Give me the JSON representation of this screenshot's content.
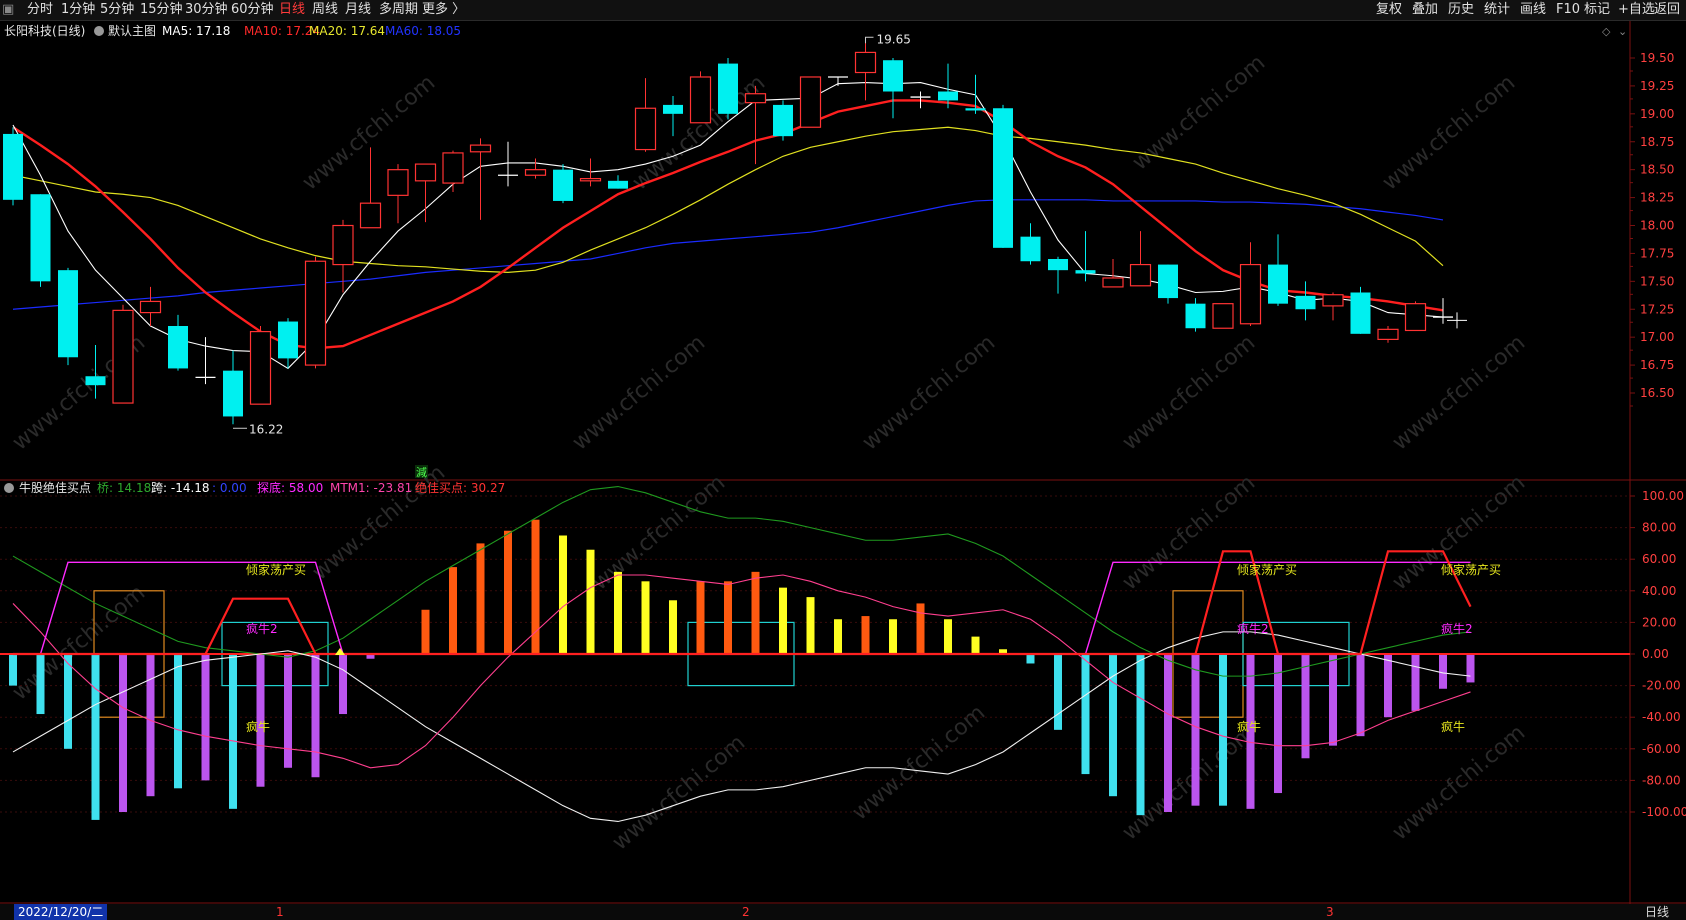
{
  "toolbar": {
    "periods": [
      "分时",
      "1分钟",
      "5分钟",
      "15分钟",
      "30分钟",
      "60分钟",
      "日线",
      "周线",
      "月线",
      "多周期",
      "更多 〉"
    ],
    "active_period": "日线",
    "right_buttons": [
      "复权",
      "叠加",
      "历史",
      "统计",
      "画线",
      "F10",
      "标记",
      "+自选",
      "返回"
    ]
  },
  "main_panel": {
    "stock_name": "长阳科技(日线)",
    "template": "默认主图",
    "ma": [
      {
        "label": "MA5: 17.18",
        "color": "#ffffff"
      },
      {
        "label": "MA10: 17.24",
        "color": "#ff2a2a"
      },
      {
        "label": "MA20: 17.64",
        "color": "#e6e62e"
      },
      {
        "label": "MA60: 18.05",
        "color": "#2233ff"
      }
    ],
    "high_label": "19.65",
    "low_label": "16.22",
    "marker": "減",
    "price_ticks": [
      "19.50",
      "19.25",
      "19.00",
      "18.75",
      "18.50",
      "18.25",
      "18.00",
      "17.75",
      "17.50",
      "17.25",
      "17.00",
      "16.75",
      "16.50"
    ]
  },
  "sub_panel": {
    "title": "牛股绝佳买点",
    "params": [
      {
        "label": "桥: 14.18",
        "color": "#2ea82e"
      },
      {
        "label": "跨: -14.18",
        "color": "#ffffff"
      },
      {
        "label": ": 0.00",
        "color": "#3344ff"
      },
      {
        "label": "探底: 58.00",
        "color": "#ff2aff"
      },
      {
        "label": "MTM1: -23.81",
        "color": "#ff44aa"
      },
      {
        "label": "绝佳买点: 30.27",
        "color": "#ff3333"
      }
    ],
    "ticks": [
      "100.00",
      "80.00",
      "60.00",
      "40.00",
      "20.00",
      "0.00",
      "-20.00",
      "-40.00",
      "-60.00",
      "-80.00",
      "-100.00"
    ],
    "annotations": {
      "qingjia": "倾家荡产买",
      "fengniu2": "疯牛2",
      "fengniu": "疯牛"
    }
  },
  "bottom": {
    "date": "2022/12/20/二",
    "month_marks": [
      "1",
      "2",
      "3"
    ],
    "period_label": "日线"
  },
  "watermark": "www.cfchi.com",
  "candles": [
    {
      "o": 18.82,
      "h": 18.88,
      "l": 18.18,
      "c": 18.23
    },
    {
      "o": 18.28,
      "h": 18.28,
      "l": 17.45,
      "c": 17.5
    },
    {
      "o": 17.6,
      "h": 17.62,
      "l": 16.75,
      "c": 16.82
    },
    {
      "o": 16.65,
      "h": 16.93,
      "l": 16.45,
      "c": 16.57
    },
    {
      "o": 16.41,
      "h": 17.29,
      "l": 16.41,
      "c": 17.24
    },
    {
      "o": 17.22,
      "h": 17.45,
      "l": 17.1,
      "c": 17.32
    },
    {
      "o": 17.1,
      "h": 17.2,
      "l": 16.7,
      "c": 16.72
    },
    {
      "o": 16.63,
      "h": 17.0,
      "l": 16.58,
      "c": 16.64
    },
    {
      "o": 16.7,
      "h": 16.88,
      "l": 16.22,
      "c": 16.29
    },
    {
      "o": 16.4,
      "h": 17.1,
      "l": 16.4,
      "c": 17.05
    },
    {
      "o": 17.14,
      "h": 17.17,
      "l": 16.72,
      "c": 16.81
    },
    {
      "o": 16.75,
      "h": 17.72,
      "l": 16.72,
      "c": 17.68
    },
    {
      "o": 17.65,
      "h": 18.05,
      "l": 17.4,
      "c": 18.0
    },
    {
      "o": 17.98,
      "h": 18.7,
      "l": 17.98,
      "c": 18.2
    },
    {
      "o": 18.27,
      "h": 18.55,
      "l": 18.02,
      "c": 18.5
    },
    {
      "o": 18.4,
      "h": 18.55,
      "l": 18.03,
      "c": 18.55
    },
    {
      "o": 18.38,
      "h": 18.67,
      "l": 18.3,
      "c": 18.65
    },
    {
      "o": 18.66,
      "h": 18.78,
      "l": 18.05,
      "c": 18.72
    },
    {
      "o": 18.45,
      "h": 18.75,
      "l": 18.35,
      "c": 18.45
    },
    {
      "o": 18.45,
      "h": 18.6,
      "l": 18.42,
      "c": 18.5
    },
    {
      "o": 18.5,
      "h": 18.55,
      "l": 18.2,
      "c": 18.22
    },
    {
      "o": 18.4,
      "h": 18.6,
      "l": 18.35,
      "c": 18.42
    },
    {
      "o": 18.4,
      "h": 18.45,
      "l": 18.33,
      "c": 18.33
    },
    {
      "o": 18.68,
      "h": 19.32,
      "l": 18.66,
      "c": 19.05
    },
    {
      "o": 19.08,
      "h": 19.16,
      "l": 18.8,
      "c": 19.0
    },
    {
      "o": 18.92,
      "h": 19.38,
      "l": 18.92,
      "c": 19.33
    },
    {
      "o": 19.45,
      "h": 19.5,
      "l": 18.95,
      "c": 19.0
    },
    {
      "o": 19.1,
      "h": 19.25,
      "l": 18.55,
      "c": 19.18
    },
    {
      "o": 19.08,
      "h": 19.12,
      "l": 18.76,
      "c": 18.8
    },
    {
      "o": 18.88,
      "h": 19.33,
      "l": 18.88,
      "c": 19.33
    },
    {
      "o": 19.33,
      "h": 19.33,
      "l": 19.25,
      "c": 19.33
    },
    {
      "o": 19.37,
      "h": 19.65,
      "l": 19.12,
      "c": 19.55
    },
    {
      "o": 19.48,
      "h": 19.5,
      "l": 18.96,
      "c": 19.2
    },
    {
      "o": 19.15,
      "h": 19.2,
      "l": 19.05,
      "c": 19.15
    },
    {
      "o": 19.2,
      "h": 19.45,
      "l": 19.05,
      "c": 19.12
    },
    {
      "o": 19.05,
      "h": 19.35,
      "l": 19.0,
      "c": 19.03
    },
    {
      "o": 19.05,
      "h": 19.08,
      "l": 17.8,
      "c": 17.8
    },
    {
      "o": 17.9,
      "h": 18.02,
      "l": 17.65,
      "c": 17.68
    },
    {
      "o": 17.7,
      "h": 17.72,
      "l": 17.39,
      "c": 17.6
    },
    {
      "o": 17.6,
      "h": 17.95,
      "l": 17.5,
      "c": 17.57
    },
    {
      "o": 17.45,
      "h": 17.7,
      "l": 17.45,
      "c": 17.53
    },
    {
      "o": 17.46,
      "h": 17.95,
      "l": 17.46,
      "c": 17.65
    },
    {
      "o": 17.65,
      "h": 17.65,
      "l": 17.3,
      "c": 17.35
    },
    {
      "o": 17.3,
      "h": 17.35,
      "l": 17.05,
      "c": 17.08
    },
    {
      "o": 17.08,
      "h": 17.3,
      "l": 17.08,
      "c": 17.3
    },
    {
      "o": 17.12,
      "h": 17.85,
      "l": 17.1,
      "c": 17.65
    },
    {
      "o": 17.65,
      "h": 17.92,
      "l": 17.28,
      "c": 17.3
    },
    {
      "o": 17.37,
      "h": 17.5,
      "l": 17.15,
      "c": 17.25
    },
    {
      "o": 17.28,
      "h": 17.4,
      "l": 17.15,
      "c": 17.38
    },
    {
      "o": 17.4,
      "h": 17.45,
      "l": 17.03,
      "c": 17.03
    },
    {
      "o": 16.98,
      "h": 17.1,
      "l": 16.95,
      "c": 17.07
    },
    {
      "o": 17.06,
      "h": 17.32,
      "l": 17.06,
      "c": 17.3
    },
    {
      "o": 17.18,
      "h": 17.35,
      "l": 17.12,
      "c": 17.18
    }
  ],
  "ma_series": {
    "ma5": [
      18.9,
      18.45,
      17.95,
      17.6,
      17.35,
      17.1,
      16.98,
      16.92,
      16.88,
      16.87,
      16.72,
      16.97,
      17.38,
      17.68,
      17.95,
      18.15,
      18.37,
      18.53,
      18.56,
      18.56,
      18.53,
      18.48,
      18.5,
      18.55,
      18.62,
      18.72,
      18.93,
      19.12,
      19.13,
      19.14,
      19.27,
      19.28,
      19.27,
      19.28,
      19.22,
      19.17,
      18.78,
      18.3,
      17.87,
      17.57,
      17.55,
      17.52,
      17.47,
      17.4,
      17.41,
      17.45,
      17.4,
      17.33,
      17.35,
      17.32,
      17.22,
      17.2,
      17.18
    ],
    "ma10": [
      18.88,
      18.72,
      18.55,
      18.35,
      18.12,
      17.88,
      17.62,
      17.4,
      17.22,
      17.05,
      16.93,
      16.9,
      16.92,
      17.02,
      17.12,
      17.22,
      17.32,
      17.45,
      17.62,
      17.8,
      17.98,
      18.13,
      18.28,
      18.38,
      18.47,
      18.57,
      18.66,
      18.76,
      18.82,
      18.92,
      19.02,
      19.07,
      19.12,
      19.12,
      19.1,
      19.07,
      18.93,
      18.75,
      18.62,
      18.52,
      18.37,
      18.17,
      17.97,
      17.77,
      17.6,
      17.5,
      17.42,
      17.4,
      17.37,
      17.35,
      17.32,
      17.28,
      17.24
    ],
    "ma20": [
      18.45,
      18.4,
      18.35,
      18.3,
      18.28,
      18.25,
      18.18,
      18.08,
      17.98,
      17.88,
      17.8,
      17.73,
      17.68,
      17.66,
      17.64,
      17.63,
      17.61,
      17.59,
      17.58,
      17.6,
      17.67,
      17.78,
      17.88,
      17.98,
      18.1,
      18.23,
      18.37,
      18.5,
      18.62,
      18.7,
      18.75,
      18.8,
      18.84,
      18.86,
      18.88,
      18.85,
      18.8,
      18.78,
      18.75,
      18.72,
      18.68,
      18.65,
      18.6,
      18.55,
      18.47,
      18.4,
      18.33,
      18.27,
      18.2,
      18.1,
      17.98,
      17.86,
      17.64
    ],
    "ma60": [
      17.25,
      17.27,
      17.29,
      17.31,
      17.33,
      17.35,
      17.37,
      17.4,
      17.42,
      17.44,
      17.46,
      17.48,
      17.5,
      17.52,
      17.55,
      17.58,
      17.6,
      17.62,
      17.64,
      17.66,
      17.68,
      17.7,
      17.75,
      17.8,
      17.84,
      17.86,
      17.88,
      17.9,
      17.92,
      17.94,
      17.98,
      18.03,
      18.08,
      18.13,
      18.18,
      18.22,
      18.23,
      18.23,
      18.23,
      18.23,
      18.22,
      18.22,
      18.22,
      18.22,
      18.21,
      18.21,
      18.2,
      18.19,
      18.17,
      18.15,
      18.12,
      18.09,
      18.05
    ]
  },
  "indicator": {
    "bars": [
      -20,
      -38,
      -60,
      -105,
      -100,
      -90,
      -85,
      -80,
      -98,
      -84,
      -72,
      -78,
      -38,
      -3,
      0,
      28,
      55,
      70,
      78,
      85,
      75,
      66,
      52,
      46,
      34,
      46,
      46,
      52,
      42,
      36,
      22,
      24,
      22,
      32,
      22,
      11,
      3,
      -6,
      -48,
      -76,
      -90,
      -102,
      -100,
      -96,
      -96,
      -98,
      -88,
      -66,
      -58,
      -52,
      -40,
      -36,
      -22,
      -18
    ],
    "bar_colors": [
      "cyan",
      "cyan",
      "cyan",
      "cyan",
      "purple",
      "purple",
      "cyan",
      "purple",
      "cyan",
      "purple",
      "purple",
      "purple",
      "purple",
      "purple",
      "red",
      "orangered",
      "orangered",
      "orangered",
      "orangered",
      "orangered",
      "yellow",
      "yellow",
      "yellow",
      "yellow",
      "yellow",
      "orangered",
      "orangered",
      "orangered",
      "yellow",
      "yellow",
      "yellow",
      "orangered",
      "yellow",
      "orangered",
      "yellow",
      "yellow",
      "yellow",
      "cyan",
      "cyan",
      "cyan",
      "cyan",
      "cyan",
      "purple",
      "purple",
      "cyan",
      "purple",
      "purple",
      "purple",
      "purple",
      "purple",
      "purple",
      "purple",
      "purple",
      "purple"
    ],
    "qiao": [
      62,
      52,
      42,
      32,
      24,
      16,
      8,
      4,
      2,
      0,
      -2,
      2,
      10,
      22,
      34,
      46,
      56,
      66,
      76,
      86,
      96,
      104,
      106,
      102,
      96,
      90,
      86,
      86,
      84,
      80,
      76,
      72,
      72,
      74,
      76,
      70,
      62,
      50,
      38,
      26,
      14,
      4,
      -4,
      -10,
      -14,
      -14,
      -12,
      -8,
      -4,
      0,
      4,
      8,
      12,
      14
    ],
    "kua": [
      -62,
      -52,
      -42,
      -32,
      -24,
      -16,
      -8,
      -4,
      -2,
      0,
      2,
      -2,
      -10,
      -22,
      -34,
      -46,
      -56,
      -66,
      -76,
      -86,
      -96,
      -104,
      -106,
      -102,
      -96,
      -90,
      -86,
      -86,
      -84,
      -80,
      -76,
      -72,
      -72,
      -74,
      -76,
      -70,
      -62,
      -50,
      -38,
      -26,
      -14,
      -4,
      4,
      10,
      14,
      14,
      12,
      8,
      4,
      0,
      -4,
      -8,
      -12,
      -14
    ],
    "mtm1": [
      32,
      14,
      -6,
      -22,
      -34,
      -42,
      -48,
      -52,
      -55,
      -58,
      -60,
      -62,
      -66,
      -72,
      -70,
      -58,
      -40,
      -20,
      -2,
      14,
      30,
      42,
      50,
      50,
      48,
      46,
      44,
      48,
      50,
      46,
      40,
      36,
      30,
      26,
      24,
      26,
      28,
      22,
      10,
      -4,
      -18,
      -28,
      -38,
      -46,
      -52,
      -56,
      -58,
      -58,
      -56,
      -50,
      -42,
      -36,
      -30,
      -24
    ],
    "tandi": [
      0,
      0,
      58,
      58,
      58,
      58,
      58,
      58,
      58,
      58,
      58,
      58,
      0,
      0,
      0,
      0,
      0,
      0,
      0,
      0,
      0,
      0,
      0,
      0,
      0,
      0,
      0,
      0,
      0,
      0,
      0,
      0,
      0,
      0,
      0,
      0,
      0,
      0,
      0,
      0,
      58,
      58,
      58,
      58,
      58,
      58,
      58,
      58,
      58,
      58,
      58,
      58,
      58,
      58
    ],
    "juejia": [
      0,
      0,
      0,
      0,
      0,
      0,
      0,
      0,
      35,
      35,
      35,
      0,
      0,
      0,
      0,
      0,
      0,
      0,
      0,
      0,
      0,
      0,
      0,
      0,
      0,
      0,
      0,
      0,
      0,
      0,
      0,
      0,
      0,
      0,
      0,
      0,
      0,
      0,
      0,
      0,
      0,
      0,
      0,
      0,
      65,
      65,
      0,
      0,
      0,
      0,
      65,
      65,
      65,
      30
    ]
  }
}
